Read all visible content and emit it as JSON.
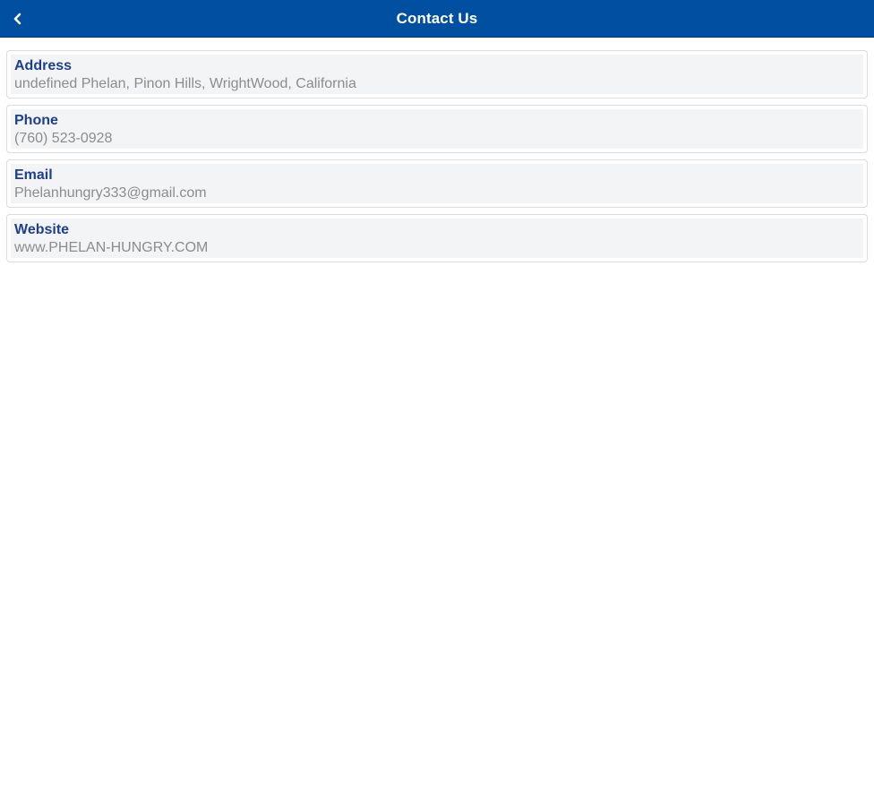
{
  "header": {
    "title": "Contact Us",
    "back_icon": "chevron-left-icon",
    "background_color": "#004fa0"
  },
  "contact": {
    "items": [
      {
        "label": "Address",
        "value": "undefined Phelan, Pinon Hills, WrightWood, California"
      },
      {
        "label": "Phone",
        "value": "(760) 523-0928"
      },
      {
        "label": "Email",
        "value": "Phelanhungry333@gmail.com"
      },
      {
        "label": "Website",
        "value": "www.PHELAN-HUNGRY.COM"
      }
    ]
  },
  "colors": {
    "label": "#1d3f8f",
    "value": "#8c8c8c",
    "card_background": "#f3f4f5"
  }
}
